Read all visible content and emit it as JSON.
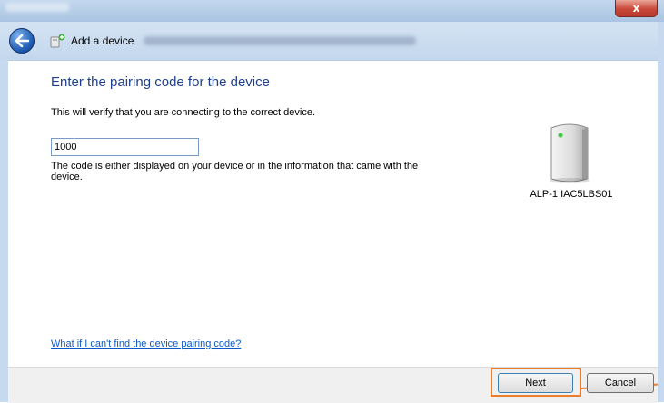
{
  "window": {
    "close_label": "x"
  },
  "nav": {
    "title": "Add a device"
  },
  "main": {
    "heading": "Enter the pairing code for the device",
    "instruction": "This will verify that you are connecting to the correct device.",
    "code_value": "1000",
    "hint": "The code is either displayed on your device or in the information that came with the device.",
    "help_link": "What if I can't find the device pairing code?"
  },
  "device": {
    "name": "ALP-1 IAC5LBS01",
    "icon": "device-tower-icon"
  },
  "footer": {
    "next_label": "Next",
    "cancel_label": "Cancel"
  },
  "colors": {
    "heading": "#1e3f8f",
    "link": "#0b59c7",
    "highlight": "#ec7d2b"
  }
}
